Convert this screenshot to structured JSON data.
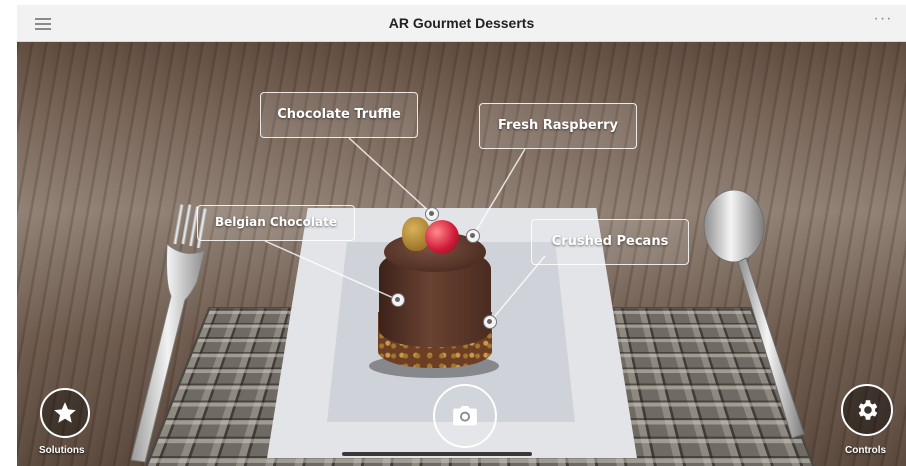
{
  "app": {
    "title": "AR Gourmet Desserts"
  },
  "toolbar": {
    "menu_icon": "hamburger-menu-icon",
    "more_icon": "more-horizontal-icon",
    "more_glyph": "···"
  },
  "annotations": [
    {
      "id": "chocolate-truffle",
      "label": "Chocolate Truffle"
    },
    {
      "id": "fresh-raspberry",
      "label": "Fresh Raspberry"
    },
    {
      "id": "belgian-chocolate",
      "label": "Belgian Chocolate"
    },
    {
      "id": "crushed-pecans",
      "label": "Crushed Pecans"
    }
  ],
  "controls": {
    "solutions_label": "Solutions",
    "controls_label": "Controls",
    "solutions_icon": "star-icon",
    "controls_icon": "gear-icon",
    "capture_icon": "camera-icon"
  },
  "colors": {
    "label_border": "#ffffff",
    "topbar_bg": "#f2f2f2",
    "button_fill": "rgba(0,0,0,0.35)"
  }
}
